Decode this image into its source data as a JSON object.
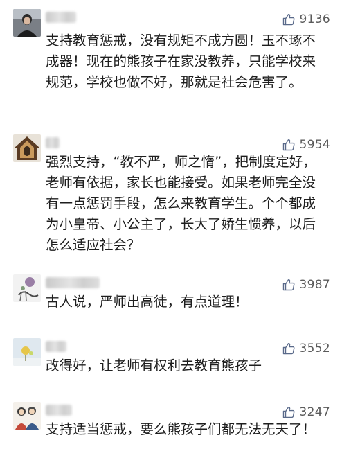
{
  "comments": [
    {
      "username": "",
      "likes": "9136",
      "text": "支持教育惩戒，没有规矩不成方圆！玉不琢不成器！现在的熊孩子在家没教养，只能学校来规范，学校也做不好，那就是社会危害了。"
    },
    {
      "username": "",
      "likes": "5954",
      "text": "强烈支持，“教不严，师之惰”，把制度定好，老师有依据，家长也能接受。如果老师完全没有一点惩罚手段，怎么来教育学生。个个都成为小皇帝、小公主了，长大了娇生惯养，以后怎么适应社会？"
    },
    {
      "username": "",
      "likes": "3987",
      "text": "古人说，严师出高徒，有点道理！"
    },
    {
      "username": "",
      "likes": "3552",
      "text": "改得好，让老师有权利去教育熊孩子"
    },
    {
      "username": "",
      "likes": "3247",
      "text": "支持适当惩戒，要么熊孩子们都无法无天了！"
    }
  ],
  "colors": {
    "background": "#ffffff",
    "text": "#1e1e1e",
    "like_count": "#5a5a5a",
    "thumb_icon": "#5a6a8a"
  },
  "icons": {
    "like": "thumbs-up-icon"
  }
}
